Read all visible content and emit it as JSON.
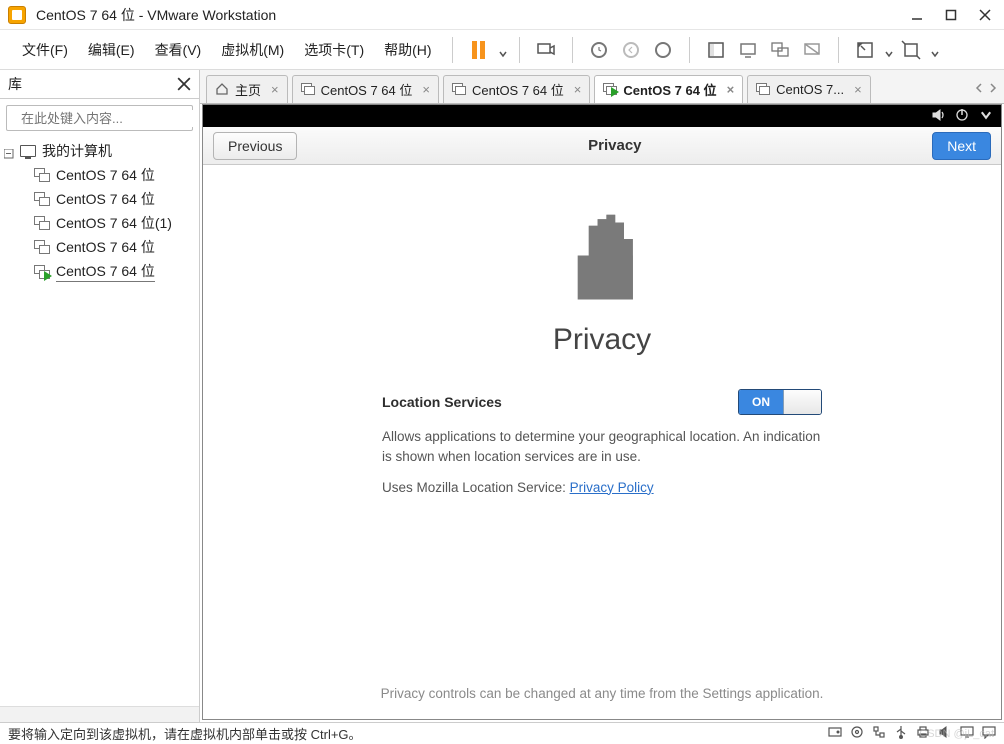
{
  "window": {
    "title": "CentOS 7 64 位 - VMware Workstation"
  },
  "menus": {
    "file": "文件(F)",
    "edit": "编辑(E)",
    "view": "查看(V)",
    "vm": "虚拟机(M)",
    "tabs": "选项卡(T)",
    "help": "帮助(H)"
  },
  "library": {
    "title": "库",
    "search_placeholder": "在此处键入内容...",
    "root": "我的计算机",
    "items": [
      {
        "label": "CentOS 7 64 位",
        "running": false
      },
      {
        "label": "CentOS 7 64 位",
        "running": false
      },
      {
        "label": "CentOS 7 64 位(1)",
        "running": false
      },
      {
        "label": "CentOS 7 64 位",
        "running": false
      },
      {
        "label": "CentOS 7 64 位",
        "running": true,
        "active": true
      }
    ]
  },
  "tabs": {
    "items": [
      {
        "label": "主页",
        "kind": "home"
      },
      {
        "label": "CentOS 7 64 位",
        "kind": "vm"
      },
      {
        "label": "CentOS 7 64 位",
        "kind": "vm"
      },
      {
        "label": "CentOS 7 64 位",
        "kind": "vm-running",
        "active": true
      },
      {
        "label": "CentOS 7...",
        "kind": "vm"
      }
    ]
  },
  "guest": {
    "prev": "Previous",
    "next": "Next",
    "header_title": "Privacy",
    "big_title": "Privacy",
    "setting_label": "Location Services",
    "switch_on": "ON",
    "desc1": "Allows applications to determine your geographical location. An indication is shown when location services are in use.",
    "desc2_prefix": "Uses Mozilla Location Service: ",
    "desc2_link": "Privacy Policy",
    "footer": "Privacy controls can be changed at any time from the Settings application."
  },
  "statusbar": {
    "msg": "要将输入定向到该虚拟机，请在虚拟机内部单击或按 Ctrl+G。"
  },
  "watermark": "CSDN @jL_cat"
}
